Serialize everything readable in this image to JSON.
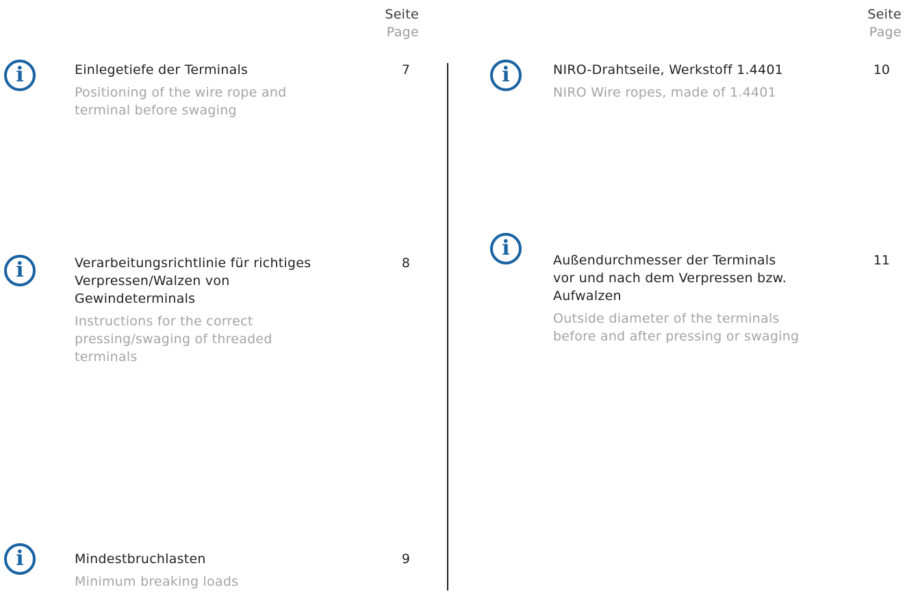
{
  "header": {
    "seite_label": "Seite",
    "page_label": "Page"
  },
  "entries": [
    {
      "title": "Einlegetiefe der Terminals",
      "subtitle": "Positioning of the wire rope and\nterminal before swaging",
      "page": "7",
      "icon": "info-icon"
    },
    {
      "title": "Verarbeitungsrichtlinie für richtiges\nVerpressen/Walzen von\nGewindeterminals",
      "subtitle": "Instructions for the correct\npressing/swaging of threaded\nterminals",
      "page": "8",
      "icon": "info-icon"
    },
    {
      "title": "Mindestbruchlasten",
      "subtitle": "Minimum breaking loads",
      "page": "9",
      "icon": "info-icon"
    },
    {
      "title": "NIRO-Drahtseile, Werkstoff 1.4401",
      "subtitle": "NIRO Wire ropes, made of 1.4401",
      "page": "10",
      "icon": "info-icon"
    },
    {
      "title": "Außendurchmesser der Terminals\nvor und nach dem Verpressen bzw.\nAufwalzen",
      "subtitle": "Outside diameter of the terminals\nbefore and after pressing or swaging",
      "page": "11",
      "icon": "info-icon"
    }
  ],
  "colors": {
    "icon": "#1a63a2",
    "title": "#222222",
    "subtitle": "#a4a4a4"
  }
}
